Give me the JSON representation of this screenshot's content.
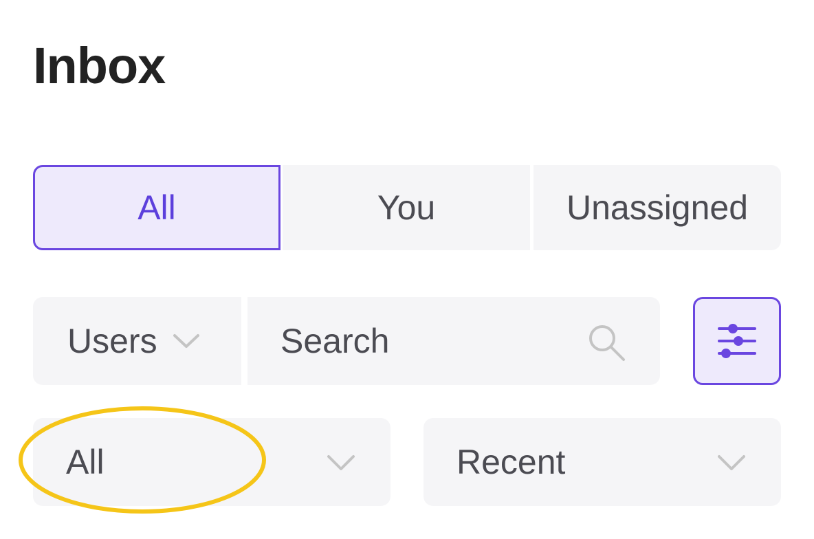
{
  "header": {
    "title": "Inbox"
  },
  "tabs": [
    {
      "label": "All",
      "selected": true
    },
    {
      "label": "You",
      "selected": false
    },
    {
      "label": "Unassigned",
      "selected": false
    }
  ],
  "filters": {
    "users_select": {
      "label": "Users",
      "icon": "chevron-down-icon"
    },
    "search": {
      "placeholder": "Search",
      "value": "",
      "icon": "search-icon"
    },
    "filter_button": {
      "icon": "sliders-icon"
    },
    "status_select": {
      "selected": "All",
      "icon": "chevron-down-icon"
    },
    "sort_select": {
      "selected": "Recent",
      "icon": "chevron-down-icon"
    }
  },
  "annotation": {
    "shape": "ellipse",
    "target": "status-select",
    "color": "#f5c518"
  },
  "colors": {
    "accent": "#6a46e0",
    "accent_text": "#5c3fdc",
    "accent_background": "#eeeafc",
    "control_background": "#f5f5f7",
    "text": "#4b4b52",
    "title_text": "#222222",
    "muted_icon": "#c4c4c4",
    "highlight": "#f5c518"
  }
}
